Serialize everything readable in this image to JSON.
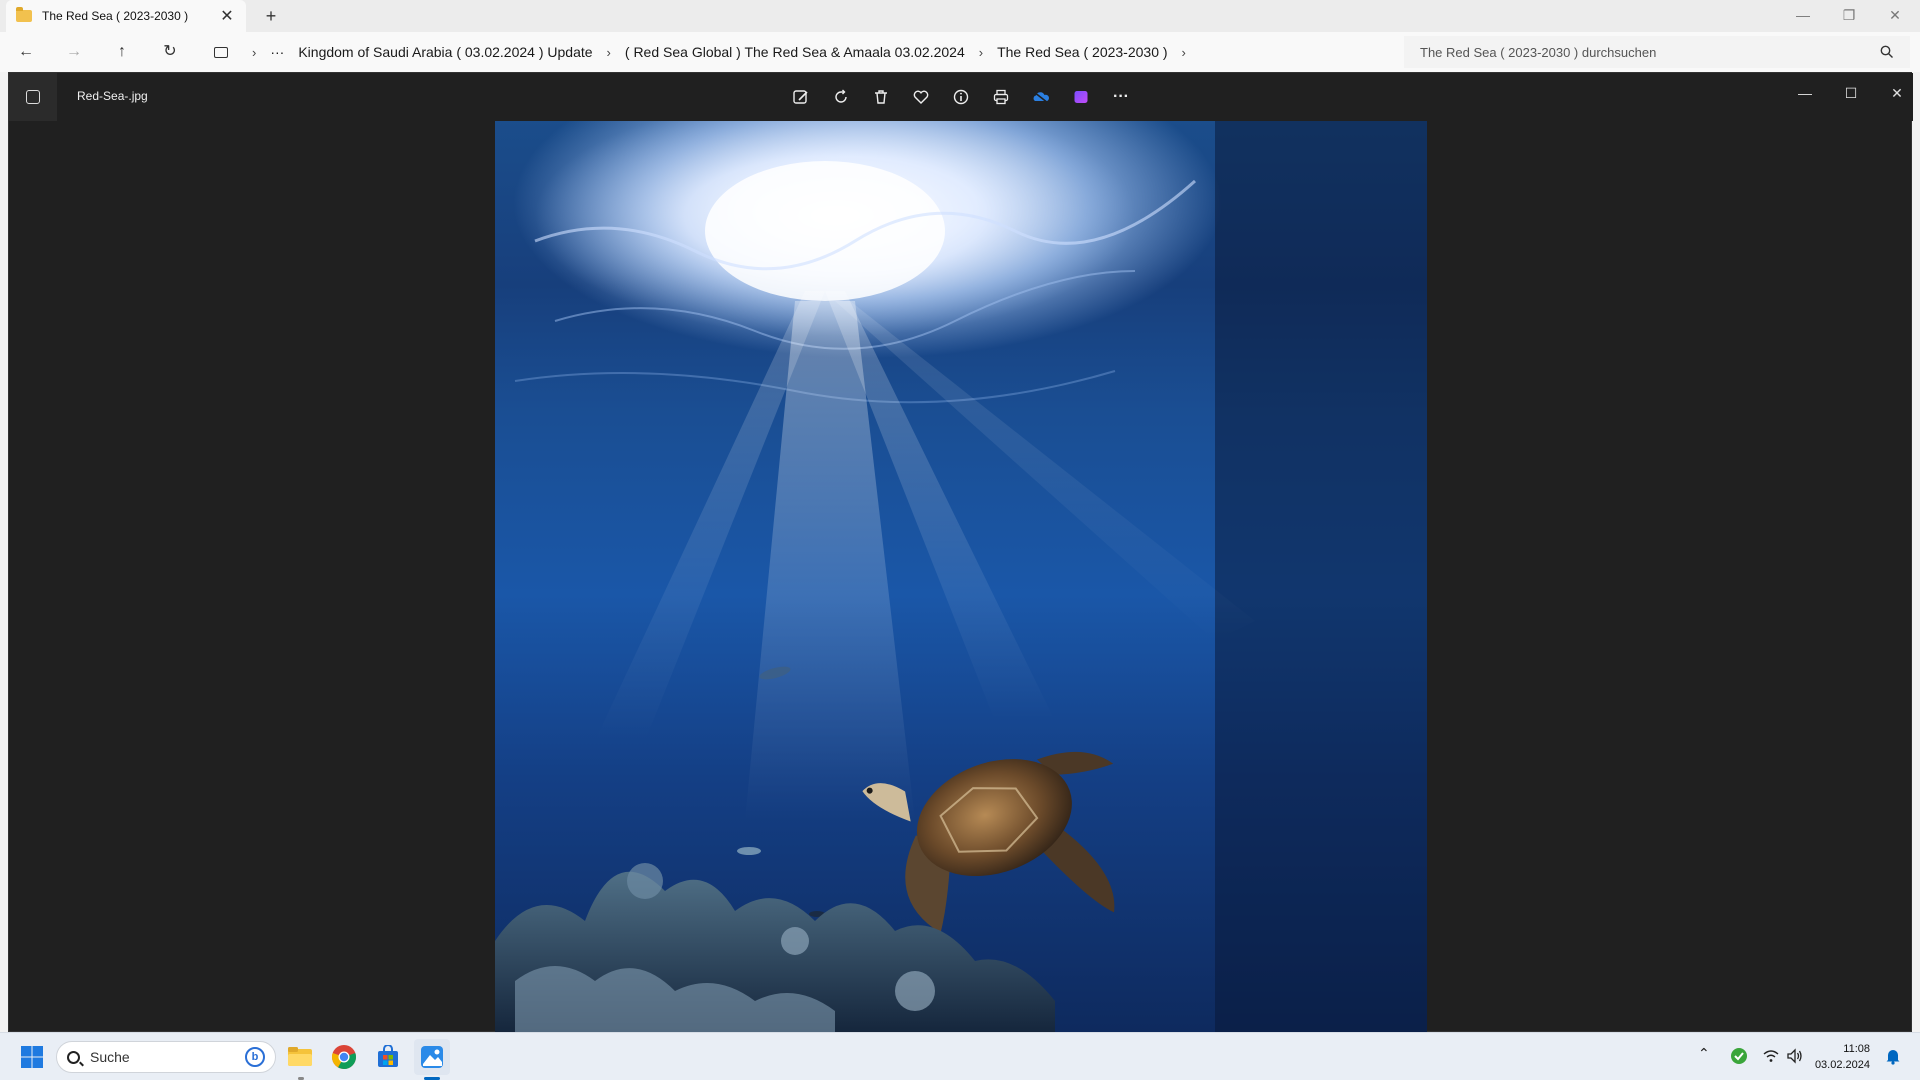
{
  "explorer": {
    "tab_title": "The Red Sea ( 2023-2030 )",
    "tab_close": "✕",
    "new_tab": "+",
    "window_controls": {
      "minimize": "—",
      "restore": "❐",
      "close": "✕"
    },
    "nav": {
      "back": "←",
      "forward": "→",
      "up": "↑",
      "refresh": "↻"
    },
    "breadcrumb": {
      "more": "···",
      "items": [
        "Kingdom of Saudi Arabia ( 03.02.2024 ) Update",
        "( Red Sea Global ) The Red Sea & Amaala 03.02.2024",
        "The Red Sea ( 2023-2030 )"
      ]
    },
    "search_placeholder": "The Red Sea ( 2023-2030 ) durchsuchen"
  },
  "photos": {
    "filename": "Red-Sea-.jpg",
    "toolbar": [
      "edit-icon",
      "rotate-icon",
      "delete-icon",
      "favorite-icon",
      "info-icon",
      "print-icon",
      "onedrive-icon",
      "clipchamp-icon",
      "more-icon"
    ],
    "more_label": "···",
    "window_controls": {
      "minimize": "—",
      "maximize": "☐",
      "close": "✕"
    }
  },
  "taskbar": {
    "search_label": "Suche",
    "bing_label": "b",
    "apps": [
      "file-explorer-icon",
      "chrome-icon",
      "store-icon",
      "photos-icon"
    ],
    "tray_chevron": "⌃",
    "clock_time": "11:08",
    "clock_date": "03.02.2024"
  },
  "colors": {
    "photos_bg": "#202020",
    "water_deep": "#0e2a5e",
    "water_mid": "#1a57a8",
    "accent": "#0067c0"
  }
}
